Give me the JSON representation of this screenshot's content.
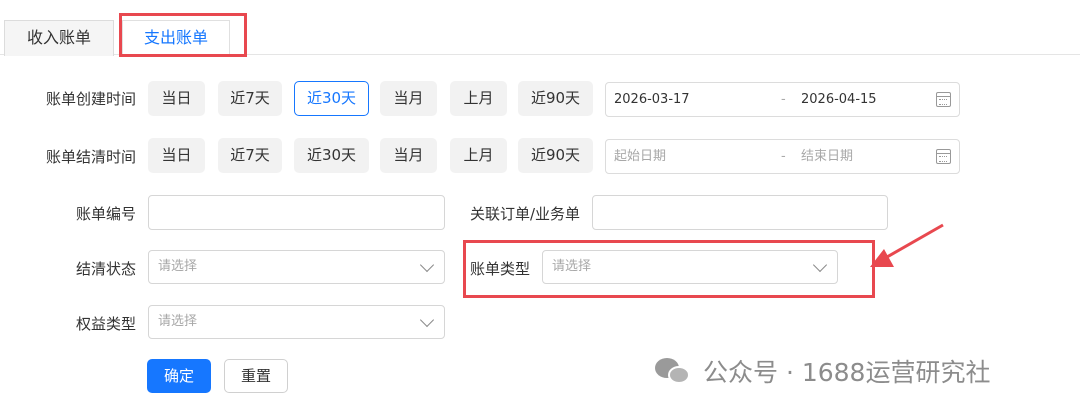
{
  "tabs": {
    "income": "收入账单",
    "expense": "支出账单"
  },
  "quick_ranges": [
    "当日",
    "近7天",
    "近30天",
    "当月",
    "上月",
    "近90天"
  ],
  "create_time": {
    "label": "账单创建时间",
    "selected": "近30天",
    "start": "2026-03-17",
    "separator": "-",
    "end": "2026-04-15"
  },
  "settle_time": {
    "label": "账单结清时间",
    "start_placeholder": "起始日期",
    "separator": "-",
    "end_placeholder": "结束日期"
  },
  "fields": {
    "bill_no_label": "账单编号",
    "order_label": "关联订单/业务单",
    "settle_status_label": "结清状态",
    "bill_type_label": "账单类型",
    "rights_type_label": "权益类型",
    "select_placeholder": "请选择"
  },
  "buttons": {
    "confirm": "确定",
    "reset": "重置"
  },
  "watermark": "公众号 · 1688运营研究社",
  "icons": [
    "calendar-icon",
    "chevron-down-icon",
    "wechat-icon",
    "arrow-annotation"
  ],
  "colors": {
    "primary": "#1677ff",
    "annotation": "#e8484f",
    "tab_inactive_bg": "#f5f5f5",
    "quick_btn_bg": "#f2f2f2"
  }
}
